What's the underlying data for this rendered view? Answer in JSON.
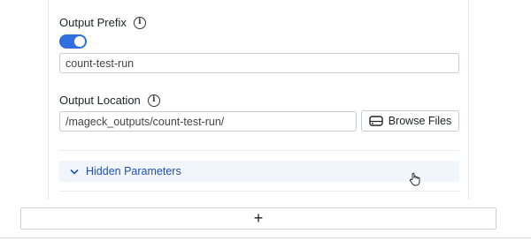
{
  "output_prefix": {
    "label": "Output Prefix",
    "info_icon": "info-icon",
    "toggle_on": true,
    "value": "count-test-run"
  },
  "output_location": {
    "label": "Output Location",
    "info_icon": "info-icon",
    "value": "/mageck_outputs/count-test-run/",
    "browse_label": "Browse Files",
    "browse_icon": "drive-icon"
  },
  "hidden_parameters": {
    "label": "Hidden Parameters",
    "icon": "chevron-down-icon"
  },
  "add_bar": {
    "label": "+"
  },
  "colors": {
    "accent": "#2f6fe0",
    "link": "#1f4fb8",
    "accordion_bg": "#f1f6fd"
  }
}
